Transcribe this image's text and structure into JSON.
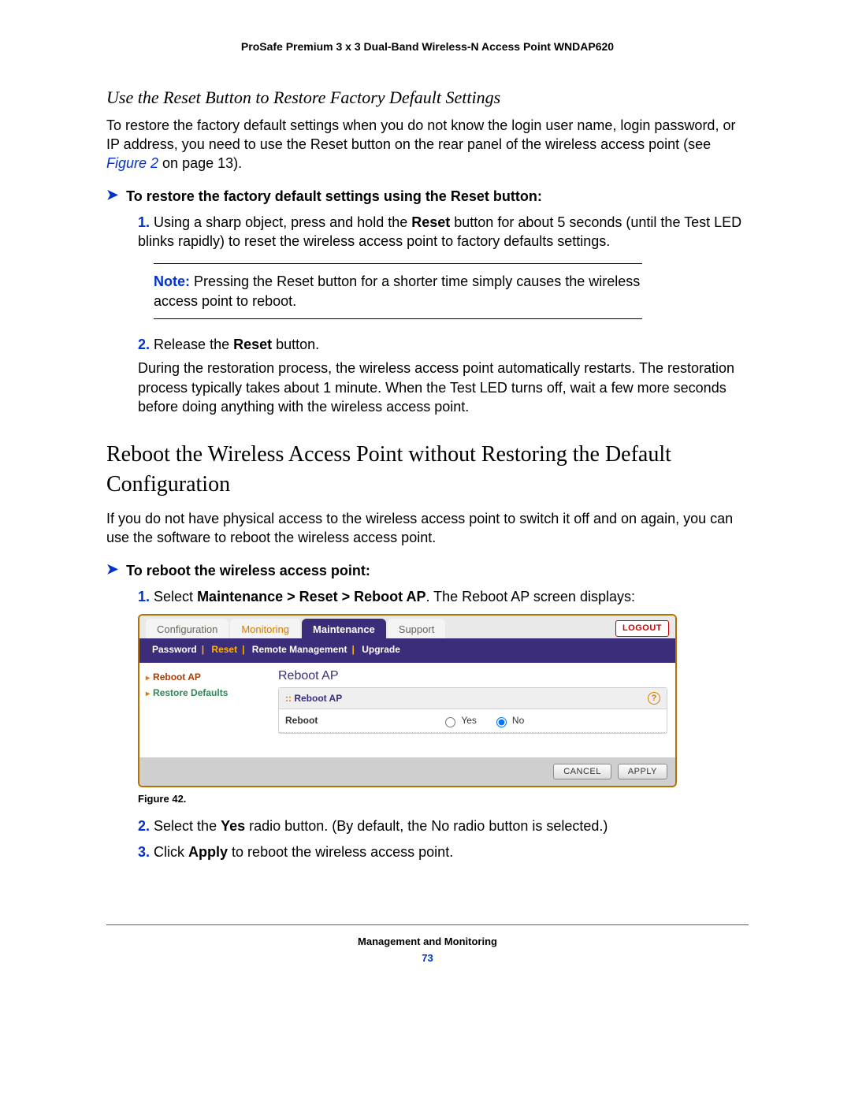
{
  "runningHeader": "ProSafe Premium 3 x 3 Dual-Band Wireless-N Access Point WNDAP620",
  "section1": {
    "title": "Use the Reset Button to Restore Factory Default Settings",
    "intro_pre": "To restore the factory default settings when you do not know the login user name, login password, or IP address, you need to use the Reset button on the rear panel of the wireless access point (see ",
    "intro_link": "Figure 2",
    "intro_post": " on page 13).",
    "procTitle": "To restore the factory default settings using the Reset button:",
    "step1_a": "Using a sharp object, press and hold the ",
    "step1_b": "Reset",
    "step1_c": " button for about 5 seconds (until the Test LED blinks rapidly) to reset the wireless access point to factory defaults settings.",
    "note_lbl": "Note:",
    "note_body": "Pressing the Reset button for a shorter time simply causes the wireless access point to reboot.",
    "step2_a": "Release the ",
    "step2_b": "Reset",
    "step2_c": " button.",
    "step2_para": "During the restoration process, the wireless access point automatically restarts. The restoration process typically takes about 1 minute. When the Test LED turns off, wait a few more seconds before doing anything with the wireless access point."
  },
  "section2": {
    "title": "Reboot the Wireless Access Point without Restoring the Default Configuration",
    "intro": "If you do not have physical access to the wireless access point to switch it off and on again, you can use the software to reboot the wireless access point.",
    "procTitle": "To reboot the wireless access point:",
    "step1_a": "Select ",
    "step1_b": "Maintenance > Reset > Reboot AP",
    "step1_c": ". The Reboot AP screen displays:",
    "figCaption": "Figure 42.",
    "step2_a": "Select the ",
    "step2_b": "Yes",
    "step2_c": " radio button. (By default, the No radio button is selected.)",
    "step3_a": "Click ",
    "step3_b": "Apply",
    "step3_c": " to reboot the wireless access point."
  },
  "ui": {
    "tabs": {
      "config": "Configuration",
      "monitor": "Monitoring",
      "maint": "Maintenance",
      "support": "Support"
    },
    "logout": "LOGOUT",
    "subnav": {
      "pwd": "Password",
      "reset": "Reset",
      "remote": "Remote Management",
      "upgrade": "Upgrade"
    },
    "sidebar": {
      "reboot": "Reboot AP",
      "restore": "Restore Defaults"
    },
    "content": {
      "title": "Reboot AP",
      "panelHead": "Reboot AP",
      "rowLabel": "Reboot",
      "yes": "Yes",
      "no": "No"
    },
    "buttons": {
      "cancel": "CANCEL",
      "apply": "APPLY"
    }
  },
  "footer": {
    "title": "Management and Monitoring",
    "page": "73"
  }
}
